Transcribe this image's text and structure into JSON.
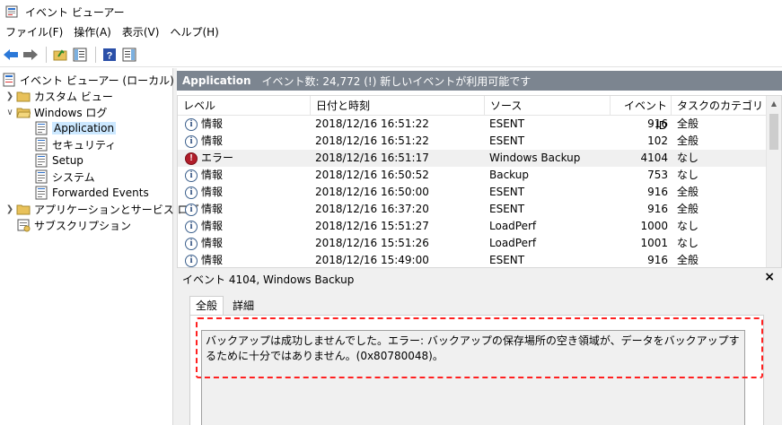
{
  "window": {
    "title": "イベント ビューアー"
  },
  "menu": [
    "ファイル(F)",
    "操作(A)",
    "表示(V)",
    "ヘルプ(H)"
  ],
  "tree": {
    "root": "イベント ビューアー (ローカル)",
    "custom_view": "カスタム ビュー",
    "windows_log": "Windows ログ",
    "application": "Application",
    "security": "セキュリティ",
    "setup": "Setup",
    "system": "システム",
    "forwarded": "Forwarded Events",
    "app_services": "アプリケーションとサービス ログ",
    "subscriptions": "サブスクリプション"
  },
  "header": {
    "title": "Application",
    "info": "イベント数: 24,772 (!) 新しいイベントが利用可能です"
  },
  "columns": {
    "level": "レベル",
    "date": "日付と時刻",
    "source": "ソース",
    "event_id": "イベント ID",
    "task": "タスクのカテゴリ"
  },
  "rows": [
    {
      "level": "情報",
      "type": "info",
      "date": "2018/12/16 16:51:22",
      "source": "ESENT",
      "event_id": "916",
      "task": "全般"
    },
    {
      "level": "情報",
      "type": "info",
      "date": "2018/12/16 16:51:22",
      "source": "ESENT",
      "event_id": "102",
      "task": "全般"
    },
    {
      "level": "エラー",
      "type": "error",
      "date": "2018/12/16 16:51:17",
      "source": "Windows Backup",
      "event_id": "4104",
      "task": "なし"
    },
    {
      "level": "情報",
      "type": "info",
      "date": "2018/12/16 16:50:52",
      "source": "Backup",
      "event_id": "753",
      "task": "なし"
    },
    {
      "level": "情報",
      "type": "info",
      "date": "2018/12/16 16:50:00",
      "source": "ESENT",
      "event_id": "916",
      "task": "全般"
    },
    {
      "level": "情報",
      "type": "info",
      "date": "2018/12/16 16:37:20",
      "source": "ESENT",
      "event_id": "916",
      "task": "全般"
    },
    {
      "level": "情報",
      "type": "info",
      "date": "2018/12/16 15:51:27",
      "source": "LoadPerf",
      "event_id": "1000",
      "task": "なし"
    },
    {
      "level": "情報",
      "type": "info",
      "date": "2018/12/16 15:51:26",
      "source": "LoadPerf",
      "event_id": "1001",
      "task": "なし"
    },
    {
      "level": "情報",
      "type": "info",
      "date": "2018/12/16 15:49:00",
      "source": "ESENT",
      "event_id": "916",
      "task": "全般"
    }
  ],
  "selected_row": 2,
  "detail": {
    "title": "イベント 4104, Windows Backup",
    "close": "×",
    "tab_general": "全般",
    "tab_details": "詳細",
    "description": "バックアップは成功しませんでした。エラー: バックアップの保存場所の空き領域が、データをバックアップするために十分ではありません。(0x80780048)。"
  },
  "colors": {
    "header_bg": "#7c8590",
    "highlight": "#ff2020",
    "selection": "#cce8ff"
  }
}
